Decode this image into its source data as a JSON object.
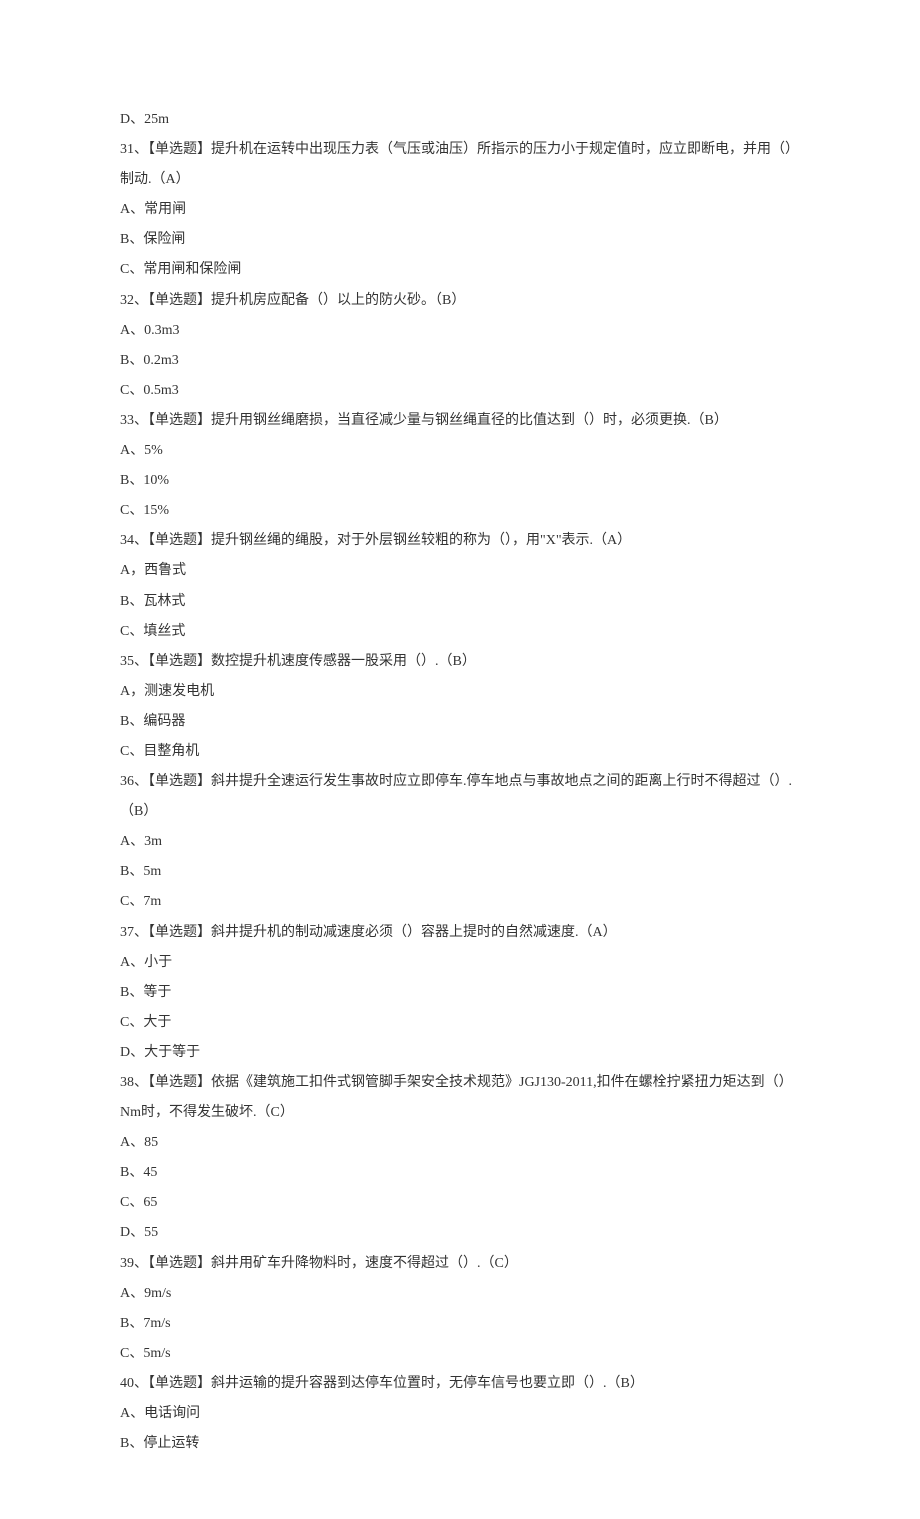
{
  "lines": [
    "D、25m",
    "31、【单选题】提升机在运转中出现压力表（气压或油压）所指示的压力小于规定值时，应立即断电，并用（）制动.（A）",
    "A、常用闸",
    "B、保险闸",
    "C、常用闸和保险闸",
    "32、【单选题】提升机房应配备（）以上的防火砂。（B）",
    "A、0.3m3",
    "B、0.2m3",
    "C、0.5m3",
    "33、【单选题】提升用钢丝绳磨损，当直径减少量与钢丝绳直径的比值达到（）时，必须更换.（B）",
    "A、5%",
    "B、10%",
    "C、15%",
    "34、【单选题】提升钢丝绳的绳股，对于外层钢丝较粗的称为（），用\"X\"表示.（A）",
    "A，西鲁式",
    "B、瓦林式",
    "C、填丝式",
    "35、【单选题】数控提升机速度传感器一股采用（）.（B）",
    "A，测速发电机",
    "B、编码器",
    "C、目整角机",
    "36、【单选题】斜井提升全速运行发生事故时应立即停车.停车地点与事故地点之间的距离上行时不得超过（）.（B）",
    "A、3m",
    "B、5m",
    "C、7m",
    "37、【单选题】斜井提升机的制动减速度必须（）容器上提时的自然减速度.（A）",
    "A、小于",
    "B、等于",
    "C、大于",
    "D、大于等于",
    "38、【单选题】依据《建筑施工扣件式钢管脚手架安全技术规范》JGJ130-2011,扣件在螺栓拧紧扭力矩达到（）Nm时，不得发生破坏.（C）",
    "A、85",
    "B、45",
    "C、65",
    "D、55",
    "39、【单选题】斜井用矿车升降物料时，速度不得超过（）.（C）",
    "A、9m/s",
    "B、7m/s",
    "C、5m/s",
    "40、【单选题】斜井运输的提升容器到达停车位置时，无停车信号也要立即（）.（B）",
    "A、电话询问",
    "B、停止运转"
  ]
}
